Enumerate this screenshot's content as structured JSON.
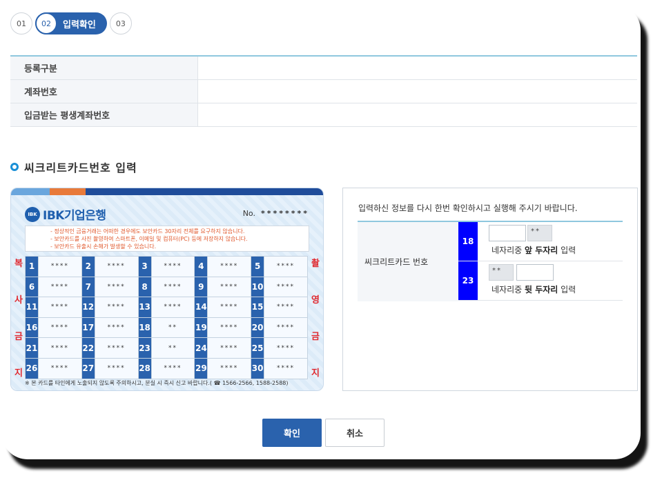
{
  "steps": [
    "01",
    "02",
    "03"
  ],
  "step_active_label": "입력확인",
  "info_rows": [
    "등록구분",
    "계좌번호",
    "입금받는 평생계좌번호"
  ],
  "section_title": "씨크리트카드번호 입력",
  "card": {
    "bank_mark": "IBK",
    "bank_name": "IBK기업은행",
    "no_label": "No.",
    "no_value": "********",
    "notices": [
      "- 정상적인 금융거래는 어떠한 경우에도 보안카드 30자리 전체를 요구하지 않습니다.",
      "- 보안카드를 사진 촬영하여 스마트폰, 이메일 및 컴퓨터(PC) 등에 저장하지 않습니다.",
      "- 보안카드 유출시 손해가 발생할 수 있습니다."
    ],
    "side_left": [
      "복",
      "사",
      "금",
      "지"
    ],
    "side_right": [
      "촬",
      "영",
      "금",
      "지"
    ],
    "cells": [
      [
        "1",
        "****"
      ],
      [
        "2",
        "****"
      ],
      [
        "3",
        "****"
      ],
      [
        "4",
        "****"
      ],
      [
        "5",
        "****"
      ],
      [
        "6",
        "****"
      ],
      [
        "7",
        "****"
      ],
      [
        "8",
        "****"
      ],
      [
        "9",
        "****"
      ],
      [
        "10",
        "****"
      ],
      [
        "11",
        "****"
      ],
      [
        "12",
        "****"
      ],
      [
        "13",
        "****"
      ],
      [
        "14",
        "****"
      ],
      [
        "15",
        "****"
      ],
      [
        "16",
        "****"
      ],
      [
        "17",
        "****"
      ],
      [
        "18",
        "**"
      ],
      [
        "19",
        "****"
      ],
      [
        "20",
        "****"
      ],
      [
        "21",
        "****"
      ],
      [
        "22",
        "****"
      ],
      [
        "23",
        "**"
      ],
      [
        "24",
        "****"
      ],
      [
        "25",
        "****"
      ],
      [
        "26",
        "****"
      ],
      [
        "27",
        "****"
      ],
      [
        "28",
        "****"
      ],
      [
        "29",
        "****"
      ],
      [
        "30",
        "****"
      ]
    ],
    "footer": "※ 본 카드를 타인에게 노출되지 않도록 주의하시고, 분실 시 즉시 신고 바랍니다.( ☎ 1566-2566, 1588-2588)"
  },
  "input_panel": {
    "message": "입력하신 정보를 다시 한번 확인하시고 실행해 주시기 바랍니다.",
    "label": "씨크리트카드 번호",
    "row1": {
      "pos": "18",
      "mask": "**",
      "hint_prefix": "네자리중 ",
      "hint_bold": "앞 두자리",
      "hint_suffix": " 입력"
    },
    "row2": {
      "pos": "23",
      "mask": "**",
      "hint_prefix": "네자리중 ",
      "hint_bold": "뒷 두자리",
      "hint_suffix": " 입력"
    }
  },
  "buttons": {
    "ok": "확인",
    "cancel": "취소"
  },
  "colors": {
    "primary": "#2a62ad",
    "position_badge": "#0000ff",
    "warning": "#e0572b"
  }
}
